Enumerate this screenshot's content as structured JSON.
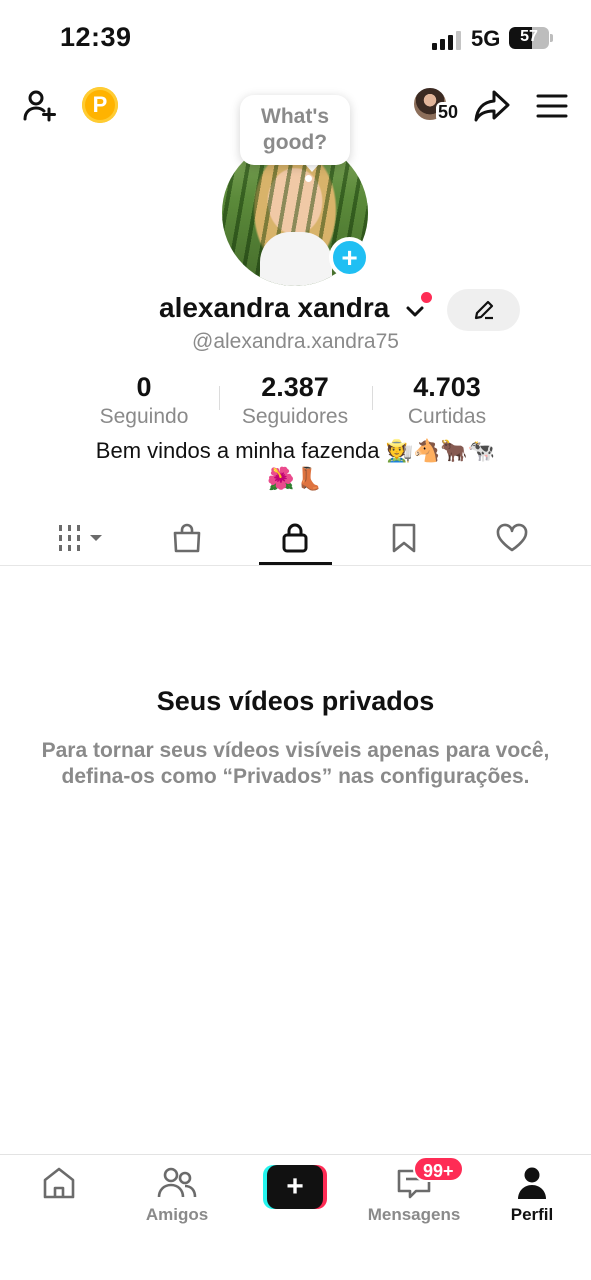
{
  "status_bar": {
    "time": "12:39",
    "network": "5G",
    "battery": "57",
    "battery_level": 0.57,
    "signal_bars": 3
  },
  "header": {
    "coin_label": "P",
    "story_count": "50"
  },
  "profile": {
    "bubble_text": "What's\ngood?",
    "display_name": "alexandra xandra",
    "username": "@alexandra.xandra75",
    "stats": [
      {
        "value": "0",
        "label": "Seguindo"
      },
      {
        "value": "2.387",
        "label": "Seguidores"
      },
      {
        "value": "4.703",
        "label": "Curtidas"
      }
    ],
    "bio_line1": "Bem vindos a minha fazenda 🧑‍🌾🐴🐂🐄",
    "bio_line2": "🌺👢"
  },
  "tabs": [
    {
      "icon": "grid-icon",
      "active": false
    },
    {
      "icon": "shopping-bag-icon",
      "active": false
    },
    {
      "icon": "lock-icon",
      "active": true
    },
    {
      "icon": "bookmark-icon",
      "active": false
    },
    {
      "icon": "heart-icon",
      "active": false
    }
  ],
  "empty_state": {
    "title": "Seus vídeos privados",
    "description": "Para tornar seus vídeos visíveis apenas para você, defina-os como “Privados” nas configurações."
  },
  "bottom_nav": {
    "items": [
      {
        "label": "",
        "icon": "home-icon"
      },
      {
        "label": "Amigos",
        "icon": "friends-icon"
      },
      {
        "label": "",
        "icon": "create-icon"
      },
      {
        "label": "Mensagens",
        "icon": "inbox-icon"
      },
      {
        "label": "Perfil",
        "icon": "profile-icon"
      }
    ],
    "messages_badge": "99+",
    "create_label": "+"
  },
  "colors": {
    "accent": "#fe2c55",
    "cyan": "#25f4ee",
    "text_secondary": "#8a8a8a",
    "plus_badge": "#20bff3"
  }
}
